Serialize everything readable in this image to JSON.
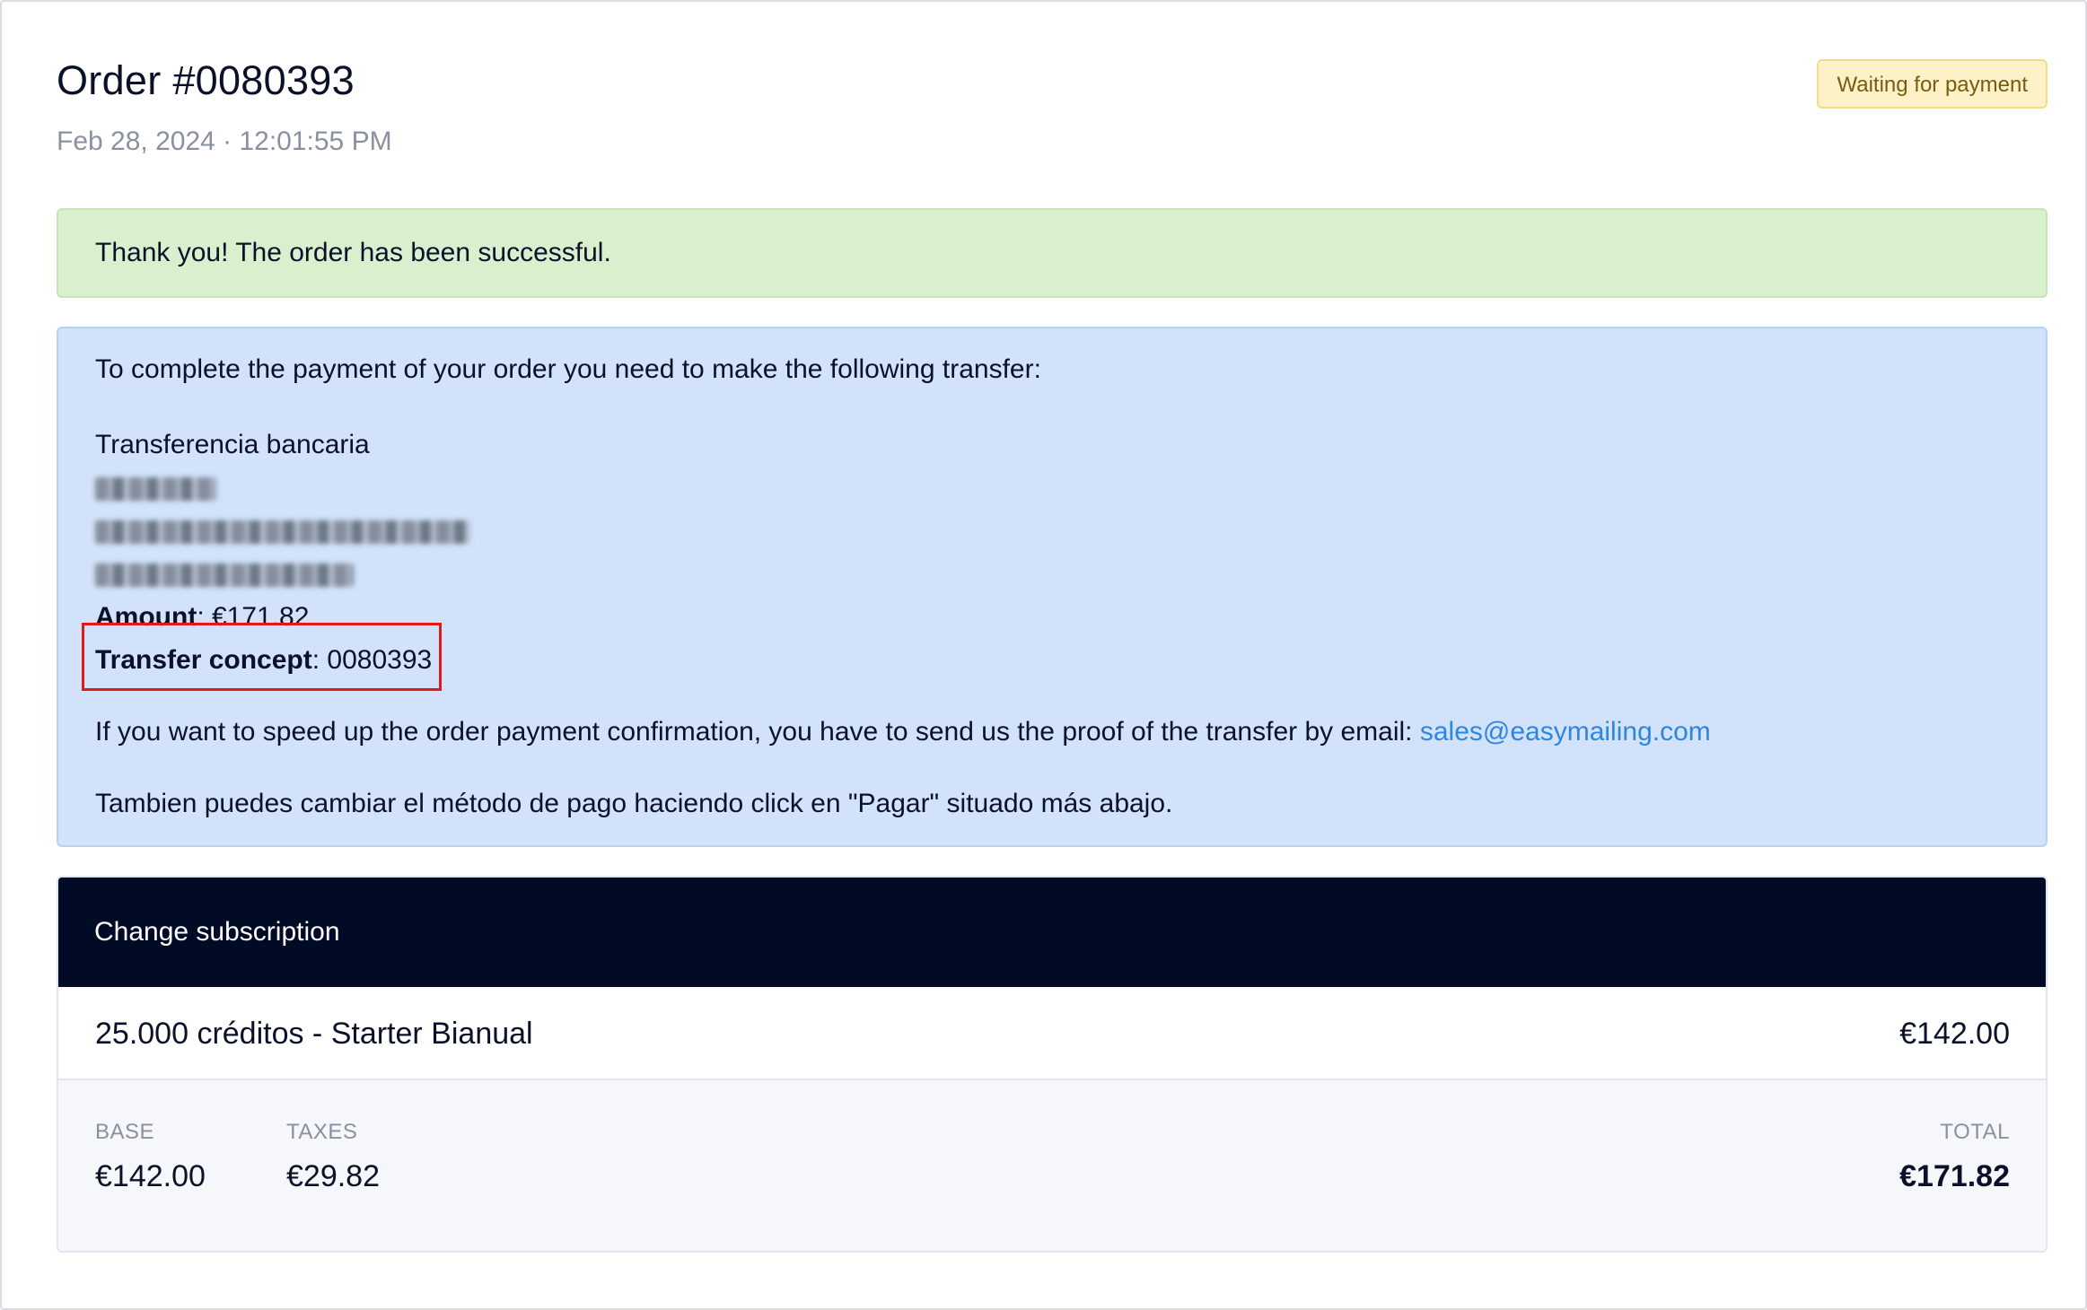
{
  "order": {
    "title": "Order #0080393",
    "date": "Feb 28, 2024 · 12:01:55 PM",
    "status": "Waiting for payment"
  },
  "success_message": "Thank you! The order has been successful.",
  "payment_info": {
    "intro": "To complete the payment of your order you need to make the following transfer:",
    "method": "Transferencia bancaria",
    "amount_label": "Amount",
    "amount_value": ": €171.82",
    "concept_label": "Transfer concept",
    "concept_value": ": 0080393",
    "speedup_text": "If you want to speed up the order payment confirmation, you have to send us the proof of the transfer by email: ",
    "email": "sales@easymailing.com",
    "change_method_text": "Tambien puedes cambiar el método de pago haciendo click en \"Pagar\" situado más abajo."
  },
  "subscription": {
    "header": "Change subscription",
    "product": "25.000 créditos - Starter Bianual",
    "product_price": "€142.00",
    "base_label": "BASE",
    "base_value": "€142.00",
    "taxes_label": "TAXES",
    "taxes_value": "€29.82",
    "total_label": "TOTAL",
    "total_value": "€171.82"
  },
  "colors": {
    "success_bg": "#d9f0ce",
    "info_bg": "#d1e2fa",
    "badge_bg": "#fdf2c7",
    "header_bg": "#020b26",
    "link": "#2f86e0",
    "highlight": "#e01a1a"
  }
}
